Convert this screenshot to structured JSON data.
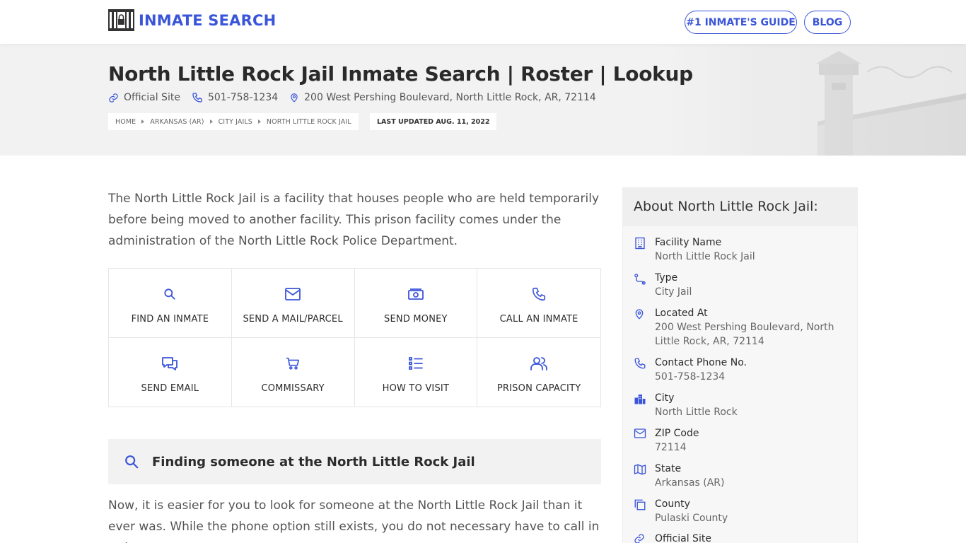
{
  "header": {
    "brand": "INMATE SEARCH",
    "nav": [
      {
        "label": "#1 INMATE'S GUIDE"
      },
      {
        "label": "BLOG"
      }
    ]
  },
  "hero": {
    "title": "North Little Rock Jail Inmate Search | Roster | Lookup",
    "official_site": "Official Site",
    "phone": "501-758-1234",
    "address": "200 West Pershing Boulevard, North Little Rock, AR, 72114",
    "breadcrumbs": [
      "HOME",
      "ARKANSAS (AR)",
      "CITY JAILS",
      "NORTH LITTLE ROCK JAIL"
    ],
    "last_updated": "LAST UPDATED AUG. 11, 2022"
  },
  "main": {
    "intro": "The North Little Rock Jail is a facility that houses people who are held temporarily before being moved to another facility. This prison facility comes under the administration of the North Little Rock Police Department.",
    "actions": [
      {
        "label": "FIND AN INMATE",
        "icon": "search-icon"
      },
      {
        "label": "SEND A MAIL/PARCEL",
        "icon": "envelope-icon"
      },
      {
        "label": "SEND MONEY",
        "icon": "money-icon"
      },
      {
        "label": "CALL AN INMATE",
        "icon": "phone-icon"
      },
      {
        "label": "SEND EMAIL",
        "icon": "chat-icon"
      },
      {
        "label": "COMMISSARY",
        "icon": "cart-icon"
      },
      {
        "label": "HOW TO VISIT",
        "icon": "list-icon"
      },
      {
        "label": "PRISON CAPACITY",
        "icon": "users-icon"
      }
    ],
    "section_title": "Finding someone at the North Little Rock Jail",
    "section_text": "Now, it is easier for you to look for someone at the North Little Rock Jail than it ever was. While the phone option still exists, you do not necessary have to call in order to"
  },
  "sidebar": {
    "title": "About North Little Rock Jail:",
    "items": [
      {
        "label": "Facility Name",
        "value": "North Little Rock Jail",
        "icon": "building-icon"
      },
      {
        "label": "Type",
        "value": "City Jail",
        "icon": "route-icon"
      },
      {
        "label": "Located At",
        "value": "200 West Pershing Boulevard, North Little Rock, AR, 72114",
        "icon": "map-pin-icon"
      },
      {
        "label": "Contact Phone No.",
        "value": "501-758-1234",
        "icon": "phone-icon"
      },
      {
        "label": "City",
        "value": "North Little Rock",
        "icon": "city-icon"
      },
      {
        "label": "ZIP Code",
        "value": "72114",
        "icon": "envelope-icon"
      },
      {
        "label": "State",
        "value": "Arkansas (AR)",
        "icon": "map-icon"
      },
      {
        "label": "County",
        "value": "Pulaski County",
        "icon": "copy-icon"
      },
      {
        "label": "Official Site",
        "value": "",
        "icon": "link-icon"
      }
    ]
  },
  "colors": {
    "accent": "#3b55d9",
    "hero_bg": "#f2f2f2",
    "text": "#2c2c2c",
    "muted": "#555555"
  }
}
